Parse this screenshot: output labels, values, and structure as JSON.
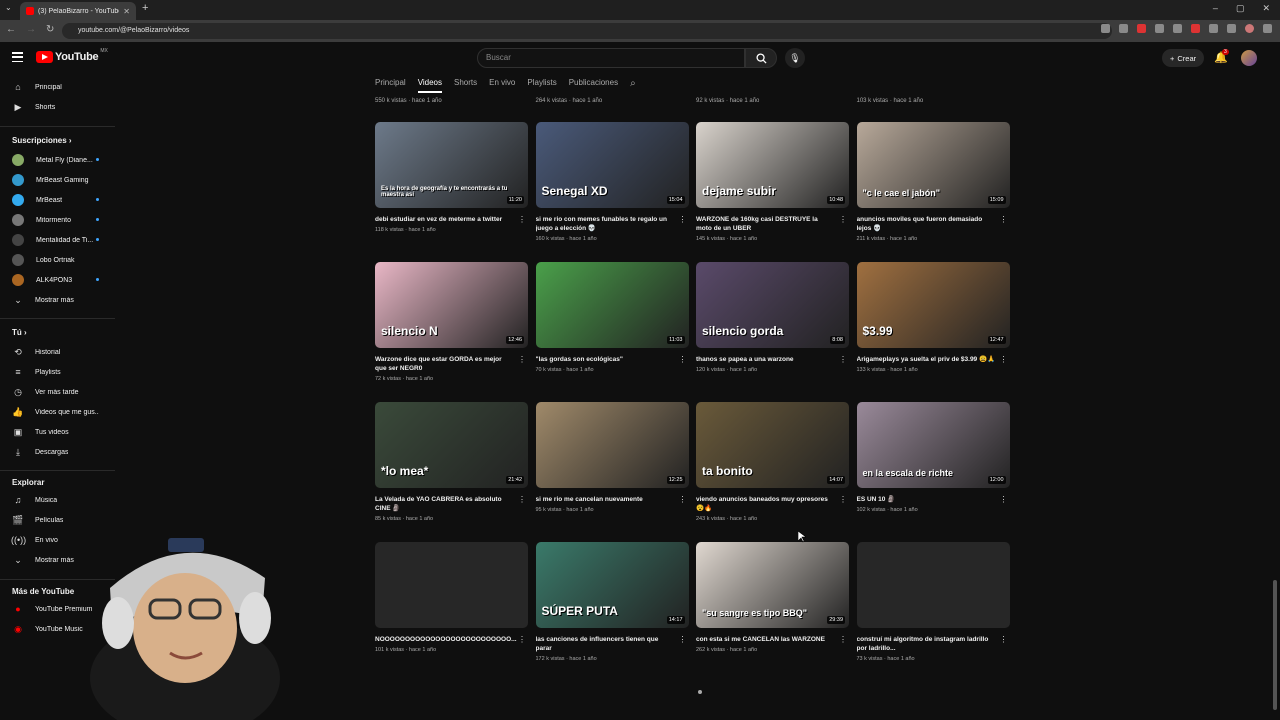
{
  "browser": {
    "tab_title": "(3) PelaoBizarro - YouTube",
    "url": "youtube.com/@PelaoBizarro/videos"
  },
  "header": {
    "logo_text": "YouTube",
    "logo_country": "MX",
    "search_placeholder": "Buscar",
    "create_label": "Crear",
    "notif_count": "3"
  },
  "sidebar": {
    "main": [
      {
        "label": "Principal",
        "icon": "home-icon"
      },
      {
        "label": "Shorts",
        "icon": "shorts-icon"
      }
    ],
    "subs_title": "Suscripciones",
    "subs": [
      {
        "label": "Metal Fly (Diane...",
        "color": "#8a6",
        "dot": true
      },
      {
        "label": "MrBeast Gaming",
        "color": "#39c",
        "dot": false
      },
      {
        "label": "MrBeast",
        "color": "#3ae",
        "dot": true
      },
      {
        "label": "Mitormento",
        "color": "#777",
        "dot": true
      },
      {
        "label": "Mentalidad de Ti...",
        "color": "#444",
        "dot": true
      },
      {
        "label": "Lobo Ortriak",
        "color": "#555",
        "dot": false
      },
      {
        "label": "ALK4PON3",
        "color": "#a62",
        "dot": true
      }
    ],
    "show_more": "Mostrar más",
    "you_title": "Tú",
    "you": [
      {
        "label": "Historial",
        "icon": "history-icon"
      },
      {
        "label": "Playlists",
        "icon": "playlists-icon"
      },
      {
        "label": "Ver más tarde",
        "icon": "watch-later-icon"
      },
      {
        "label": "Videos que me gus...",
        "icon": "like-icon"
      },
      {
        "label": "Tus videos",
        "icon": "your-videos-icon"
      },
      {
        "label": "Descargas",
        "icon": "download-icon"
      }
    ],
    "explore_title": "Explorar",
    "explore": [
      {
        "label": "Música",
        "icon": "music-icon"
      },
      {
        "label": "Películas",
        "icon": "movies-icon"
      },
      {
        "label": "En vivo",
        "icon": "live-icon"
      },
      {
        "label": "Mostrar más",
        "icon": "chevron-down-icon"
      }
    ],
    "more_title": "Más de YouTube",
    "more": [
      {
        "label": "YouTube Premium",
        "icon": "yt-premium-icon"
      },
      {
        "label": "YouTube Music",
        "icon": "yt-music-icon"
      }
    ]
  },
  "channel_tabs": [
    "Principal",
    "Videos",
    "Shorts",
    "En vivo",
    "Playlists",
    "Publicaciones"
  ],
  "prev_row_meta": [
    "550 k vistas · hace 1 año",
    "264 k vistas · hace 1 año",
    "92 k vistas · hace 1 año",
    "103 k vistas · hace 1 año"
  ],
  "videos": [
    {
      "title": "debi estudiar en vez de meterme a twitter",
      "meta": "118 k vistas · hace 1 año",
      "duration": "11:20",
      "caption": "Es la hora de geografía y te encontrarás a tu maestra así",
      "bg": "#6d7a8a"
    },
    {
      "title": "si me rio con memes funables te regalo un juego a elección 💀",
      "meta": "160 k vistas · hace 1 año",
      "duration": "15:04",
      "caption": "Senegal XD",
      "bg": "#4a5a7a"
    },
    {
      "title": "WARZONE de 160kg casi DESTRUYE la moto de un UBER",
      "meta": "145 k vistas · hace 1 año",
      "duration": "10:48",
      "caption": "dejame subir",
      "bg": "#d9d3cc"
    },
    {
      "title": "anuncios moviles que fueron demasiado lejos 💀",
      "meta": "211 k vistas · hace 1 año",
      "duration": "15:09",
      "caption": "\"c le cae el jabón\"",
      "bg": "#b8a99a"
    },
    {
      "title": "Warzone dice que estar GORDA es mejor que ser NEGR0",
      "meta": "72 k vistas · hace 1 año",
      "duration": "12:46",
      "caption": "silencio N",
      "bg": "#e9b7c6"
    },
    {
      "title": "\"las gordas son ecológicas\"",
      "meta": "70 k vistas · hace 1 año",
      "duration": "11:03",
      "caption": "",
      "bg": "#4aa04a"
    },
    {
      "title": "thanos se papea a una warzone",
      "meta": "120 k vistas · hace 1 año",
      "duration": "8:08",
      "caption": "silencio gorda",
      "bg": "#5a4a6a"
    },
    {
      "title": "Arigameplays ya suelta el priv de $3.99 😩🙏",
      "meta": "133 k vistas · hace 1 año",
      "duration": "12:47",
      "caption": "$3.99",
      "bg": "#a07040"
    },
    {
      "title": "La Velada de YAO CABRERA es absoluto CINE 🗿",
      "meta": "85 k vistas · hace 1 año",
      "duration": "21:42",
      "caption": "*lo mea*",
      "bg": "#3a4a3a"
    },
    {
      "title": "si me rio me cancelan nuevamente",
      "meta": "95 k vistas · hace 1 año",
      "duration": "12:25",
      "caption": "",
      "bg": "#a08a6a"
    },
    {
      "title": "viendo anuncios baneados muy opresores 😵🔥",
      "meta": "243 k vistas · hace 1 año",
      "duration": "14:07",
      "caption": "ta bonito",
      "bg": "#6a5a3a"
    },
    {
      "title": "ES UN 10 🗿",
      "meta": "102 k vistas · hace 1 año",
      "duration": "12:00",
      "caption": "en la escala de richte",
      "bg": "#9a8a9a"
    },
    {
      "title": "NOOOOOOOOOOOOOOOOOOOOOOOOOO...",
      "meta": "101 k vistas · hace 1 año",
      "duration": "",
      "caption": "",
      "bg": "#272727"
    },
    {
      "title": "las canciones de influencers tienen que parar",
      "meta": "172 k vistas · hace 1 año",
      "duration": "14:17",
      "caption": "SÚPER PUTA",
      "bg": "#3a7a6a"
    },
    {
      "title": "con esta si me CANCELAN las WARZONE",
      "meta": "262 k vistas · hace 1 año",
      "duration": "29:39",
      "caption": "\"su sangre es tipo BBQ\"",
      "bg": "#e0d8d0"
    },
    {
      "title": "construí mi algoritmo de instagram ladrillo por ladrillo...",
      "meta": "73 k vistas · hace 1 año",
      "duration": "",
      "caption": "",
      "bg": "#272727"
    }
  ]
}
